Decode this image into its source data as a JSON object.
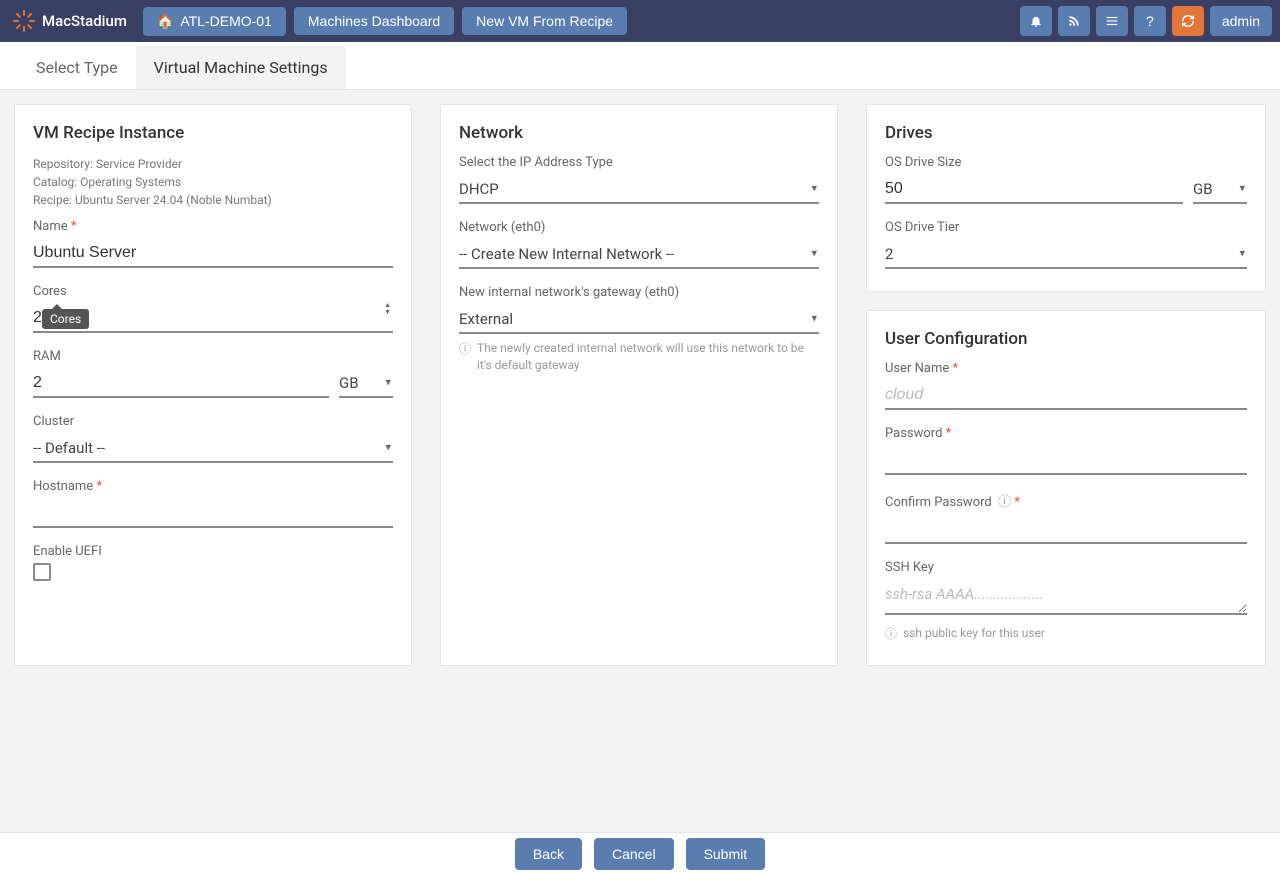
{
  "brand": "MacStadium",
  "nav": {
    "home": "ATL-DEMO-01",
    "dashboard": "Machines Dashboard",
    "newvm": "New VM From Recipe",
    "admin": "admin"
  },
  "tabs": {
    "select_type": "Select Type",
    "vm_settings": "Virtual Machine Settings"
  },
  "recipe": {
    "title": "VM Recipe Instance",
    "repo": "Repository: Service Provider",
    "catalog": "Catalog: Operating Systems",
    "recipe_line": "Recipe: Ubuntu Server 24.04 (Noble Numbat)",
    "name_label": "Name",
    "name_value": "Ubuntu Server",
    "cores_label": "Cores",
    "cores_value": "2",
    "cores_tooltip": "Cores",
    "ram_label": "RAM",
    "ram_value": "2",
    "ram_unit": "GB",
    "cluster_label": "Cluster",
    "cluster_value": "-- Default --",
    "hostname_label": "Hostname",
    "hostname_value": "",
    "uefi_label": "Enable UEFI"
  },
  "network": {
    "title": "Network",
    "ip_label": "Select the IP Address Type",
    "ip_value": "DHCP",
    "eth_label": "Network (eth0)",
    "eth_value": " -- Create New Internal Network --",
    "gw_label": "New internal network's gateway (eth0)",
    "gw_value": "External",
    "gw_hint": "The newly created internal network will use this network to be it's default gateway"
  },
  "drives": {
    "title": "Drives",
    "size_label": "OS Drive Size",
    "size_value": "50",
    "size_unit": "GB",
    "tier_label": "OS Drive Tier",
    "tier_value": "2"
  },
  "user": {
    "title": "User Configuration",
    "username_label": "User Name",
    "username_placeholder": "cloud",
    "password_label": "Password",
    "confirm_label": "Confirm Password",
    "ssh_label": "SSH Key",
    "ssh_placeholder": "ssh-rsa AAAA..................",
    "ssh_hint": "ssh public key for this user"
  },
  "footer": {
    "back": "Back",
    "cancel": "Cancel",
    "submit": "Submit"
  }
}
